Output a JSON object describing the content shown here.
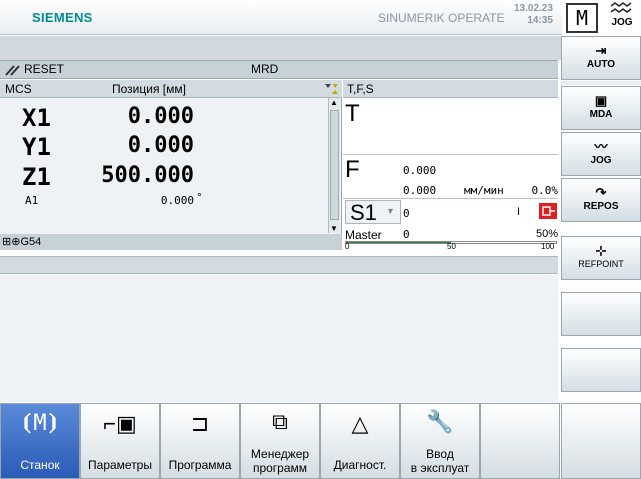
{
  "header": {
    "brand": "SIEMENS",
    "product": "SINUMERIK OPERATE",
    "date": "13.02.23",
    "time": "14:35",
    "mode_letter": "M",
    "mode_jog": "JOG"
  },
  "status": {
    "reset": "RESET",
    "mrd": "MRD"
  },
  "positions": {
    "header_left": "MCS",
    "header_right": "Позиция [мм]",
    "axes": [
      {
        "name": "X1",
        "value": "0.000"
      },
      {
        "name": "Y1",
        "value": "0.000"
      },
      {
        "name": "Z1",
        "value": "500.000"
      },
      {
        "name": "A1",
        "value": "0.000",
        "unit": "°"
      }
    ],
    "frame": "G54"
  },
  "tfs": {
    "header": "T,F,S",
    "t_label": "T",
    "f_label": "F",
    "f_value": "0.000",
    "f_actual": "0.000",
    "f_unit": "мм/мин",
    "f_percent": "0.0%",
    "s_label": "S1",
    "s_value": "0",
    "s_dir": "I",
    "master_label": "Master",
    "master_value": "0",
    "master_percent": "50%",
    "master_fraction": 0.5,
    "scale": [
      "0",
      "50",
      "100"
    ]
  },
  "vertical_softkeys": [
    {
      "label": "AUTO"
    },
    {
      "label": "MDA"
    },
    {
      "label": "JOG"
    },
    {
      "label": "REPOS"
    },
    {
      "label": "REFPOINT"
    }
  ],
  "horizontal_softkeys": [
    {
      "line1": "Станок",
      "line2": ""
    },
    {
      "line1": "Параметры",
      "line2": ""
    },
    {
      "line1": "Программа",
      "line2": ""
    },
    {
      "line1": "Менеджер",
      "line2": "программ"
    },
    {
      "line1": "Диагност.",
      "line2": ""
    },
    {
      "line1": "Ввод",
      "line2": "в эксплуат"
    }
  ]
}
